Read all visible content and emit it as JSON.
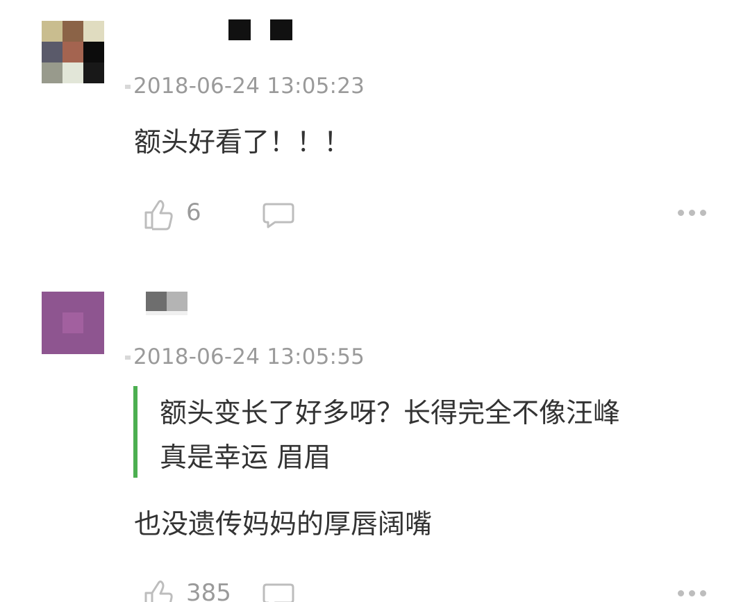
{
  "comments": [
    {
      "avatar_colors": [
        "#c9bd8f",
        "#8b6347",
        "#e0dcc0",
        "#5a5a6a",
        "#a46450",
        "#0c0c0c",
        "#989a8c",
        "#e2e6d8",
        "#181818"
      ],
      "timestamp": "2018-06-24 13:05:23",
      "text": "额头好看了！！！",
      "likes": "6"
    },
    {
      "avatar_colors": [
        "#8e5590",
        "#a2609f"
      ],
      "timestamp": "2018-06-24 13:05:55",
      "quote_lines": [
        "额头变长了好多呀？长得完全不像汪峰",
        "真是幸运 眉眉"
      ],
      "text": "也没遗传妈妈的厚唇阔嘴",
      "likes": "385"
    }
  ],
  "colors": {
    "quote_bar": "#4caf50",
    "meta_text": "#9a9a9a",
    "body_text": "#333333"
  },
  "icons": {
    "like": "thumbs-up-icon",
    "reply": "speech-bubble-icon",
    "more": "more-dots-icon"
  }
}
